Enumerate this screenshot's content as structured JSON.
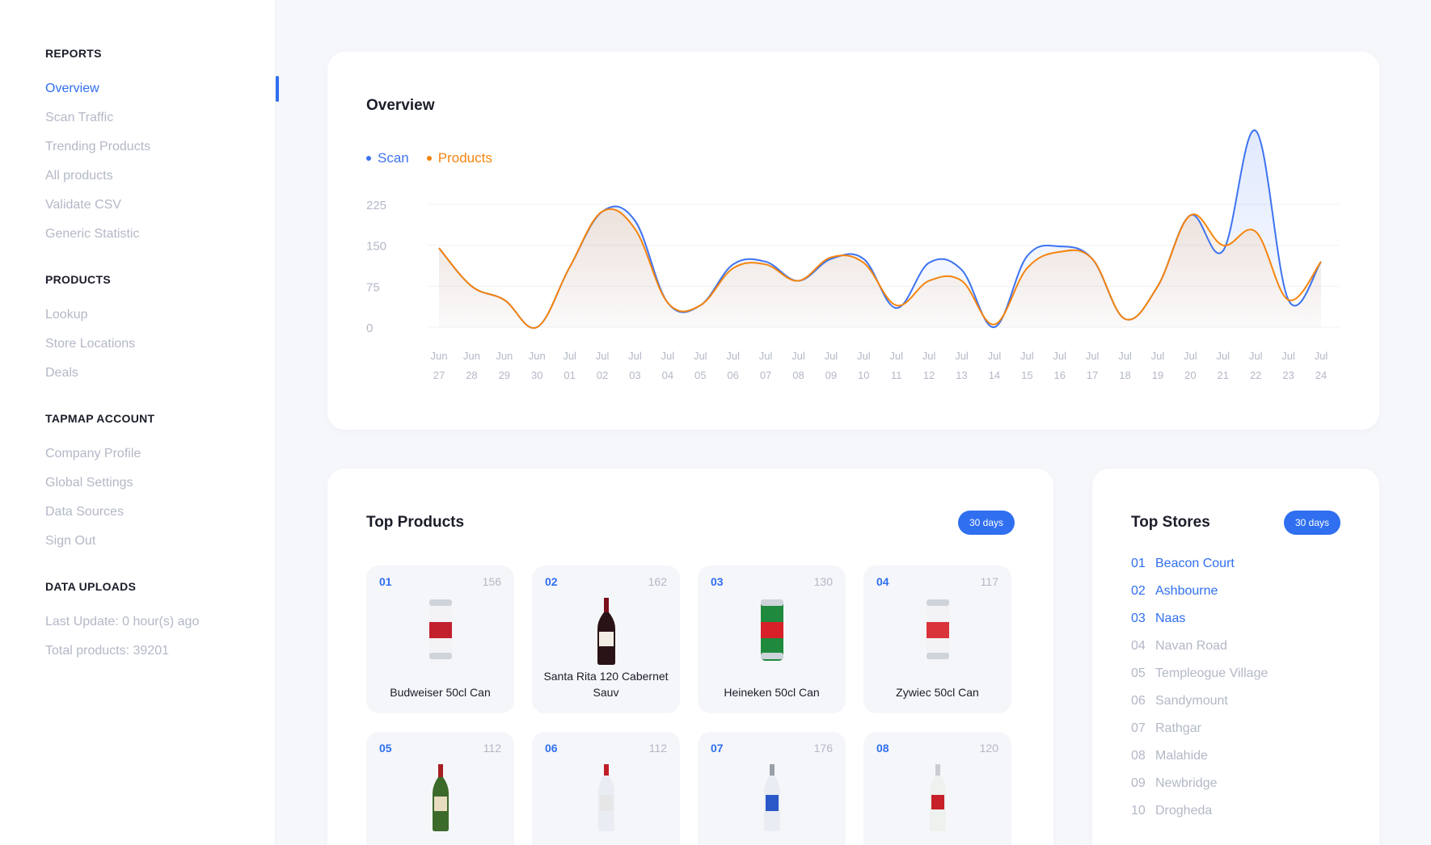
{
  "sidebar": {
    "sections": [
      {
        "heading": "REPORTS",
        "items": [
          "Overview",
          "Scan Traffic",
          "Trending Products",
          "All products",
          "Validate CSV",
          "Generic Statistic"
        ]
      },
      {
        "heading": "PRODUCTS",
        "items": [
          "Lookup",
          "Store Locations",
          "Deals"
        ]
      },
      {
        "heading": "TAPMAP ACCOUNT",
        "items": [
          "Company Profile",
          "Global Settings",
          "Data Sources",
          "Sign Out"
        ]
      },
      {
        "heading": "DATA UPLOADS",
        "items": [
          "Last Update: 0 hour(s) ago",
          "Total products: 39201"
        ]
      }
    ],
    "active_item": "Overview"
  },
  "overview": {
    "title": "Overview",
    "legend": {
      "scan": "Scan",
      "products": "Products"
    }
  },
  "colors": {
    "accent": "#2f6ff0",
    "scan_line": "#3d73f0",
    "products_line": "#f5840e",
    "muted": "#b3b8c6"
  },
  "chart_data": {
    "type": "line",
    "title": "Overview",
    "xlabel": "",
    "ylabel": "",
    "x": [
      "Jun 27",
      "Jun 28",
      "Jun 29",
      "Jun 30",
      "Jul 01",
      "Jul 02",
      "Jul 03",
      "Jul 04",
      "Jul 05",
      "Jul 06",
      "Jul 07",
      "Jul 08",
      "Jul 09",
      "Jul 10",
      "Jul 11",
      "Jul 12",
      "Jul 13",
      "Jul 14",
      "Jul 15",
      "Jul 16",
      "Jul 17",
      "Jul 18",
      "Jul 19",
      "Jul 20",
      "Jul 21",
      "Jul 22",
      "Jul 23",
      "Jul 24"
    ],
    "x_ticks_top": [
      "Jun",
      "Jun",
      "Jun",
      "Jun",
      "Jul",
      "Jul",
      "Jul",
      "Jul",
      "Jul",
      "Jul",
      "Jul",
      "Jul",
      "Jul",
      "Jul",
      "Jul",
      "Jul",
      "Jul",
      "Jul",
      "Jul",
      "Jul",
      "Jul",
      "Jul",
      "Jul",
      "Jul",
      "Jul",
      "Jul",
      "Jul",
      "Jul"
    ],
    "x_ticks_bottom": [
      "27",
      "28",
      "29",
      "30",
      "01",
      "02",
      "03",
      "04",
      "05",
      "06",
      "07",
      "08",
      "09",
      "10",
      "11",
      "12",
      "13",
      "14",
      "15",
      "16",
      "17",
      "18",
      "19",
      "20",
      "21",
      "22",
      "23",
      "24"
    ],
    "y_ticks": [
      "225",
      "150",
      "75",
      "0"
    ],
    "ylim": [
      0,
      225
    ],
    "grid": true,
    "legend_position": "top-left",
    "series": [
      {
        "name": "Scan",
        "values": [
          145,
          75,
          50,
          0,
          110,
          212,
          195,
          45,
          40,
          115,
          120,
          85,
          125,
          125,
          35,
          118,
          105,
          0,
          130,
          148,
          125,
          15,
          75,
          205,
          140,
          360,
          50,
          120
        ]
      },
      {
        "name": "Products",
        "values": [
          145,
          75,
          50,
          0,
          110,
          212,
          180,
          45,
          40,
          108,
          115,
          85,
          128,
          118,
          40,
          85,
          85,
          5,
          108,
          138,
          125,
          15,
          75,
          205,
          150,
          175,
          50,
          120
        ]
      }
    ]
  },
  "top_products": {
    "title": "Top Products",
    "range": "30 days",
    "items": [
      {
        "rank": "01",
        "count": "156",
        "name": "Budweiser 50cl Can",
        "icon": "beer-can-icon"
      },
      {
        "rank": "02",
        "count": "162",
        "name": "Santa Rita 120 Cabernet Sauv",
        "icon": "wine-bottle-icon"
      },
      {
        "rank": "03",
        "count": "130",
        "name": "Heineken 50cl Can",
        "icon": "beer-can-icon"
      },
      {
        "rank": "04",
        "count": "117",
        "name": "Zywiec 50cl Can",
        "icon": "beer-can-icon"
      },
      {
        "rank": "05",
        "count": "112",
        "name": "",
        "icon": "whiskey-bottle-icon"
      },
      {
        "rank": "06",
        "count": "112",
        "name": "",
        "icon": "vodka-bottle-icon"
      },
      {
        "rank": "07",
        "count": "176",
        "name": "",
        "icon": "vodka-bottle-icon"
      },
      {
        "rank": "08",
        "count": "120",
        "name": "",
        "icon": "rum-bottle-icon"
      }
    ]
  },
  "top_stores": {
    "title": "Top Stores",
    "range": "30 days",
    "items": [
      {
        "rank": "01",
        "name": "Beacon Court"
      },
      {
        "rank": "02",
        "name": "Ashbourne"
      },
      {
        "rank": "03",
        "name": "Naas"
      },
      {
        "rank": "04",
        "name": "Navan Road"
      },
      {
        "rank": "05",
        "name": "Templeogue Village"
      },
      {
        "rank": "06",
        "name": "Sandymount"
      },
      {
        "rank": "07",
        "name": "Rathgar"
      },
      {
        "rank": "08",
        "name": "Malahide"
      },
      {
        "rank": "09",
        "name": "Newbridge"
      },
      {
        "rank": "10",
        "name": "Drogheda"
      }
    ]
  }
}
